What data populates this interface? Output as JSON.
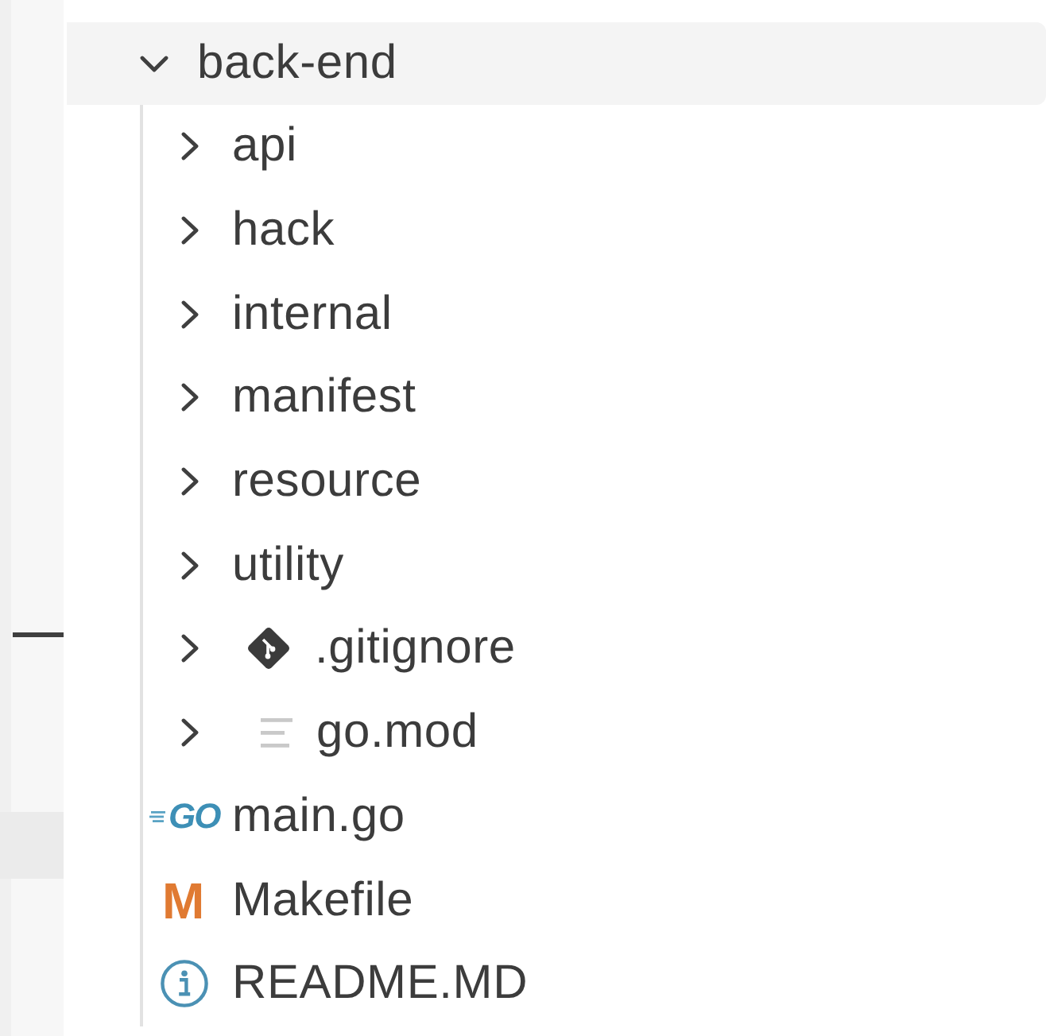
{
  "explorer": {
    "folder": {
      "name": "back-end",
      "expanded": true,
      "children": [
        {
          "name": "api",
          "kind": "folder",
          "expanded": false
        },
        {
          "name": "hack",
          "kind": "folder",
          "expanded": false
        },
        {
          "name": "internal",
          "kind": "folder",
          "expanded": false
        },
        {
          "name": "manifest",
          "kind": "folder",
          "expanded": false
        },
        {
          "name": "resource",
          "kind": "folder",
          "expanded": false
        },
        {
          "name": "utility",
          "kind": "folder",
          "expanded": false
        },
        {
          "name": ".gitignore",
          "kind": "git",
          "expanded": false
        },
        {
          "name": "go.mod",
          "kind": "text",
          "expanded": false
        },
        {
          "name": "main.go",
          "kind": "go",
          "icon_text": "GO"
        },
        {
          "name": "Makefile",
          "kind": "makefile",
          "icon_text": "M"
        },
        {
          "name": "README.MD",
          "kind": "info"
        }
      ]
    }
  }
}
